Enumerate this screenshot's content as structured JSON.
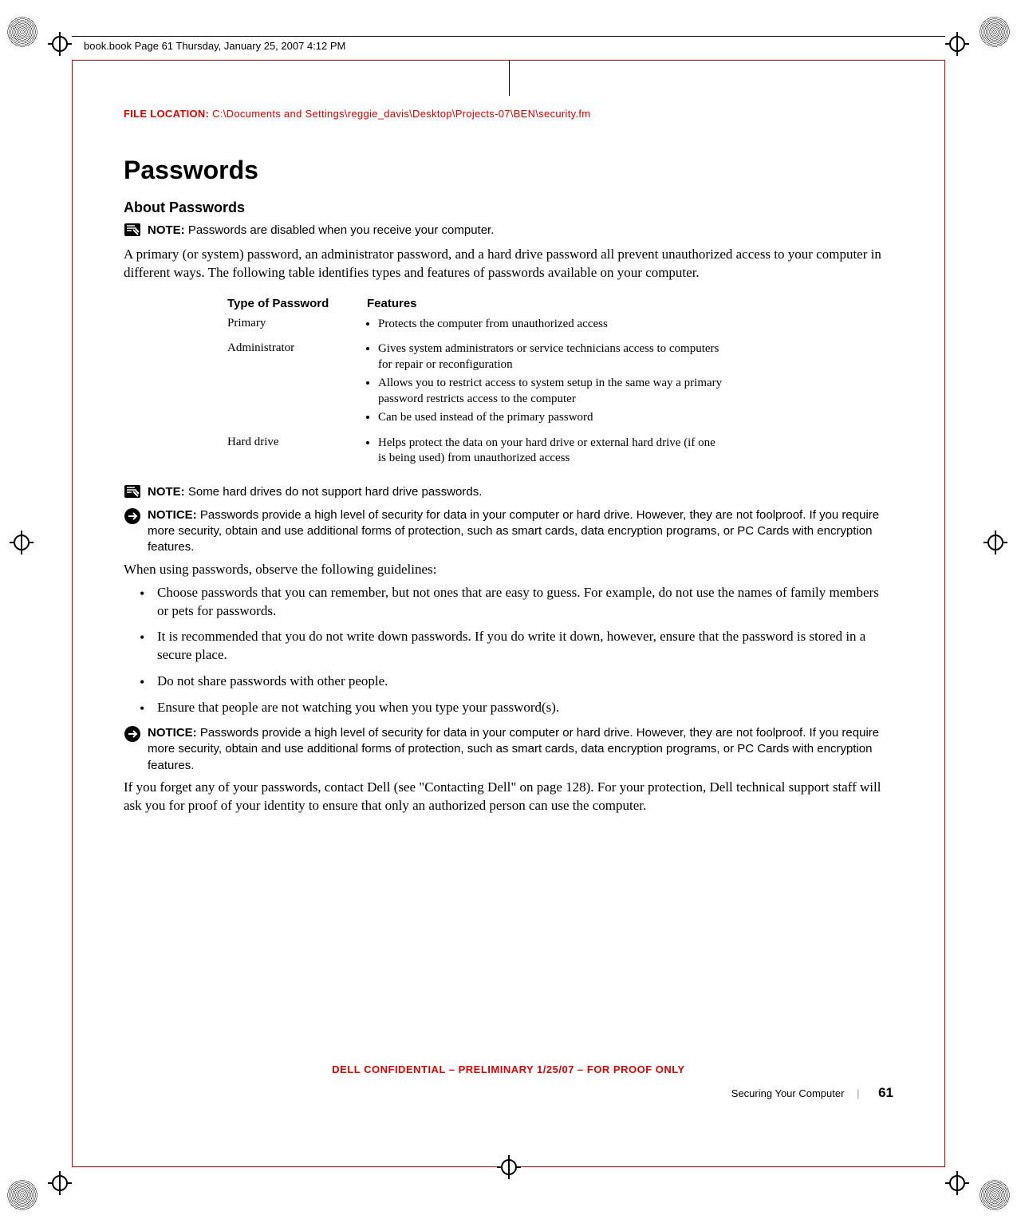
{
  "header_text": "book.book  Page 61  Thursday, January 25, 2007  4:12 PM",
  "file_location_label": "FILE LOCATION:",
  "file_location_path": "C:\\Documents and Settings\\reggie_davis\\Desktop\\Projects-07\\BEN\\security.fm",
  "h1": "Passwords",
  "h2": "About Passwords",
  "note1_label": "NOTE:",
  "note1_text": "Passwords are disabled when you receive your computer.",
  "para1": "A primary (or system) password, an administrator password, and a hard drive password all prevent unauthorized access to your computer in different ways. The following table identifies types and features of passwords available on your computer.",
  "table": {
    "head_type": "Type of Password",
    "head_features": "Features",
    "rows": [
      {
        "type": "Primary",
        "features": [
          "Protects the computer from unauthorized access"
        ]
      },
      {
        "type": "Administrator",
        "features": [
          "Gives system administrators or service technicians access to computers for repair or reconfiguration",
          "Allows you to restrict access to system setup in the same way a primary password restricts access to the computer",
          "Can be used instead of the primary password"
        ]
      },
      {
        "type": "Hard drive",
        "features": [
          "Helps protect the data on your hard drive or external hard drive (if one is being used) from unauthorized access"
        ]
      }
    ]
  },
  "note2_label": "NOTE:",
  "note2_text": "Some hard drives do not support hard drive passwords.",
  "notice1_label": "NOTICE:",
  "notice1_text": "Passwords provide a high level of security for data in your computer or hard drive. However, they are not foolproof. If you require more security, obtain and use additional forms of protection, such as smart cards, data encryption programs, or PC Cards with encryption features.",
  "para2": "When using passwords, observe the following guidelines:",
  "guidelines": [
    "Choose passwords that you can remember, but not ones that are easy to guess. For example, do not use the names of family members or pets for passwords.",
    "It is recommended that you do not write down passwords. If you do write it down, however, ensure that the password is stored in a secure place.",
    "Do not share passwords with other people.",
    "Ensure that people are not watching you when you type your password(s)."
  ],
  "notice2_label": "NOTICE:",
  "notice2_text": "Passwords provide a high level of security for data in your computer or hard drive. However, they are not foolproof. If you require more security, obtain and use additional forms of protection, such as smart cards, data encryption programs, or PC Cards with encryption features.",
  "para3": "If you forget any of your passwords, contact Dell (see \"Contacting Dell\" on page 128). For your protection, Dell technical support staff will ask you for proof of your identity to ensure that only an authorized person can use the computer.",
  "footer_confidential": "DELL CONFIDENTIAL – PRELIMINARY 1/25/07 – FOR PROOF ONLY",
  "footer_section": "Securing Your Computer",
  "footer_page": "61"
}
